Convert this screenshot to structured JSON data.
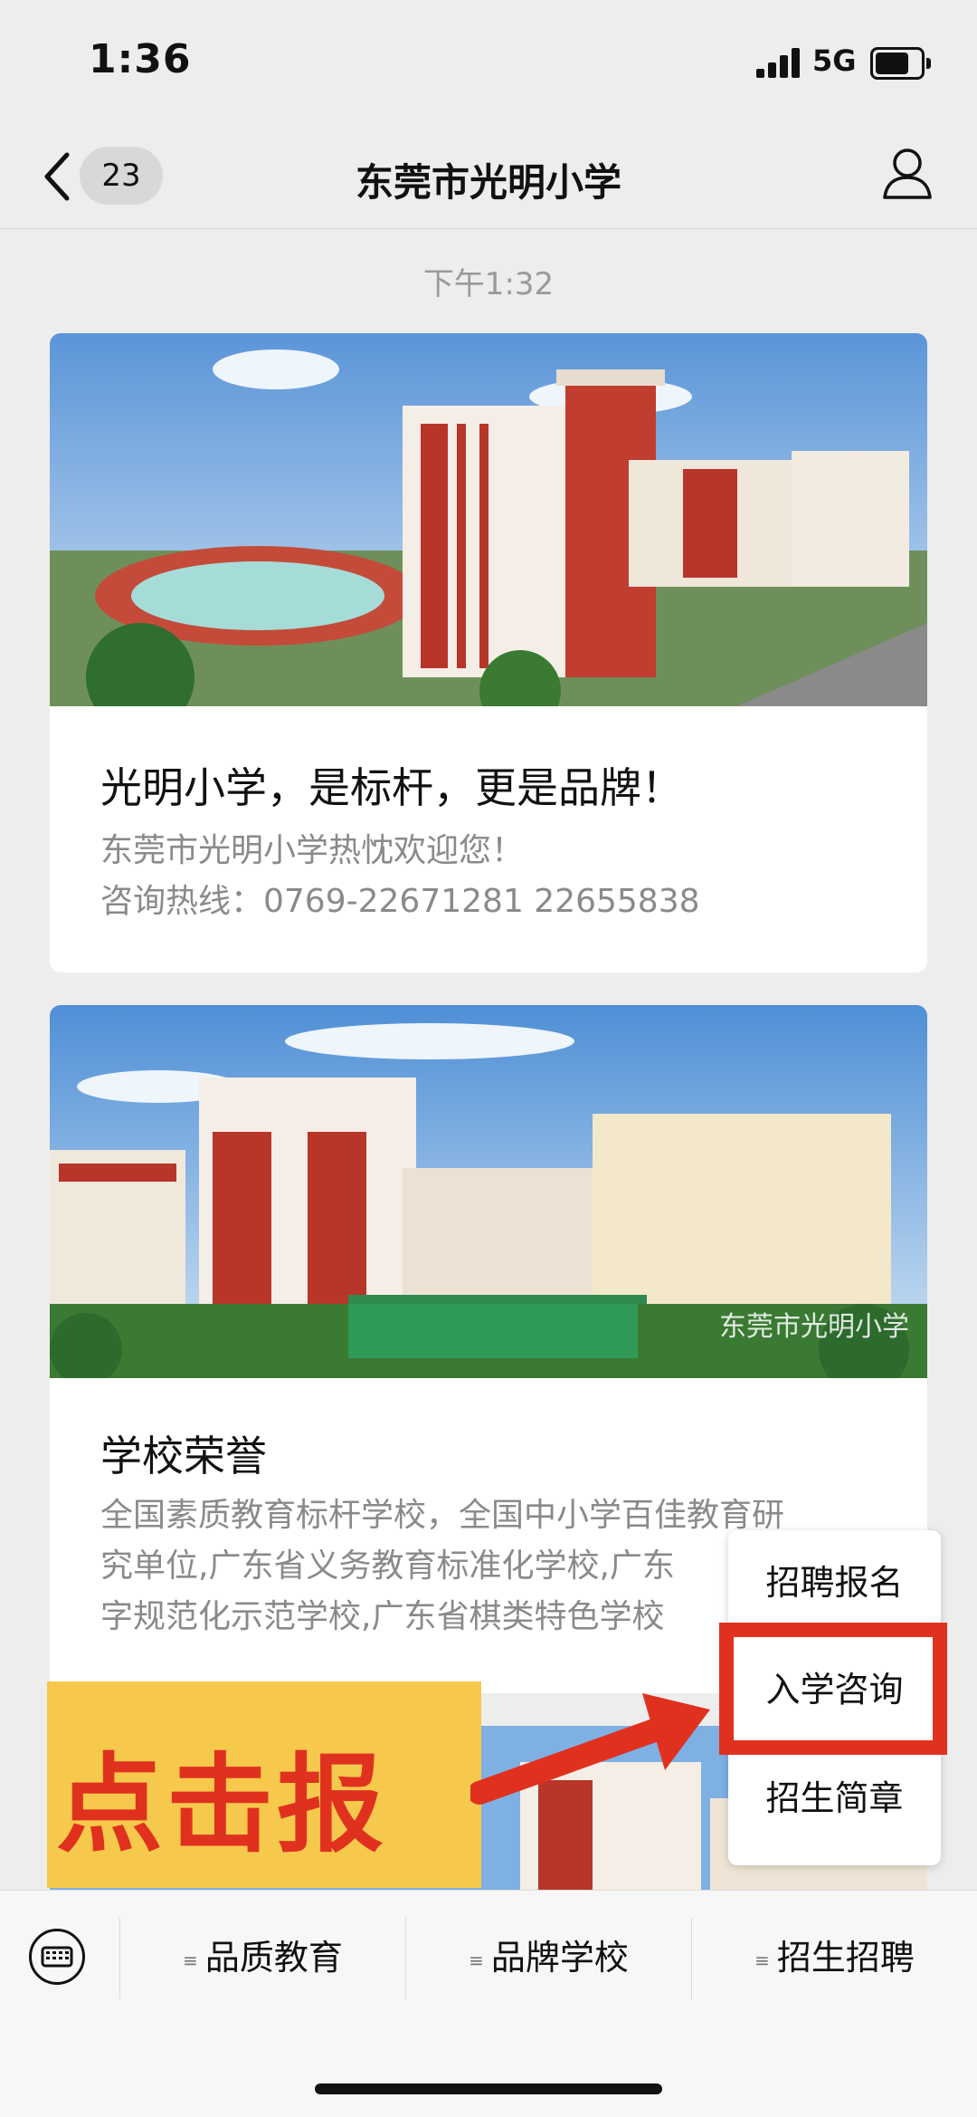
{
  "status_bar": {
    "time": "1:36",
    "network": "5G"
  },
  "nav": {
    "badge_count": "23",
    "title": "东莞市光明小学"
  },
  "timestamp": "下午1:32",
  "articles": [
    {
      "title": "光明小学，是标杆，更是品牌！",
      "desc_lines": [
        "东莞市光明小学热忱欢迎您！",
        "咨询热线：0769-22671281    22655838"
      ]
    },
    {
      "title": "学校荣誉",
      "desc_lines": [
        "全国素质教育标杆学校，全国中小学百佳教育研",
        "究单位,广东省义务教育标准化学校,广东",
        "字规范化示范学校,广东省棋类特色学校"
      ],
      "watermark": "东莞市光明小学"
    }
  ],
  "popup_menu": {
    "items": [
      "招聘报名",
      "入学咨询",
      "招生简章"
    ],
    "highlighted": "入学咨询"
  },
  "annotation": {
    "label": "点击报名"
  },
  "bottom_menu": {
    "tabs": [
      "品质教育",
      "品牌学校",
      "招生招聘"
    ]
  },
  "colors": {
    "annotation_red": "#e0311f",
    "annotation_yellow": "#f6c94c"
  }
}
